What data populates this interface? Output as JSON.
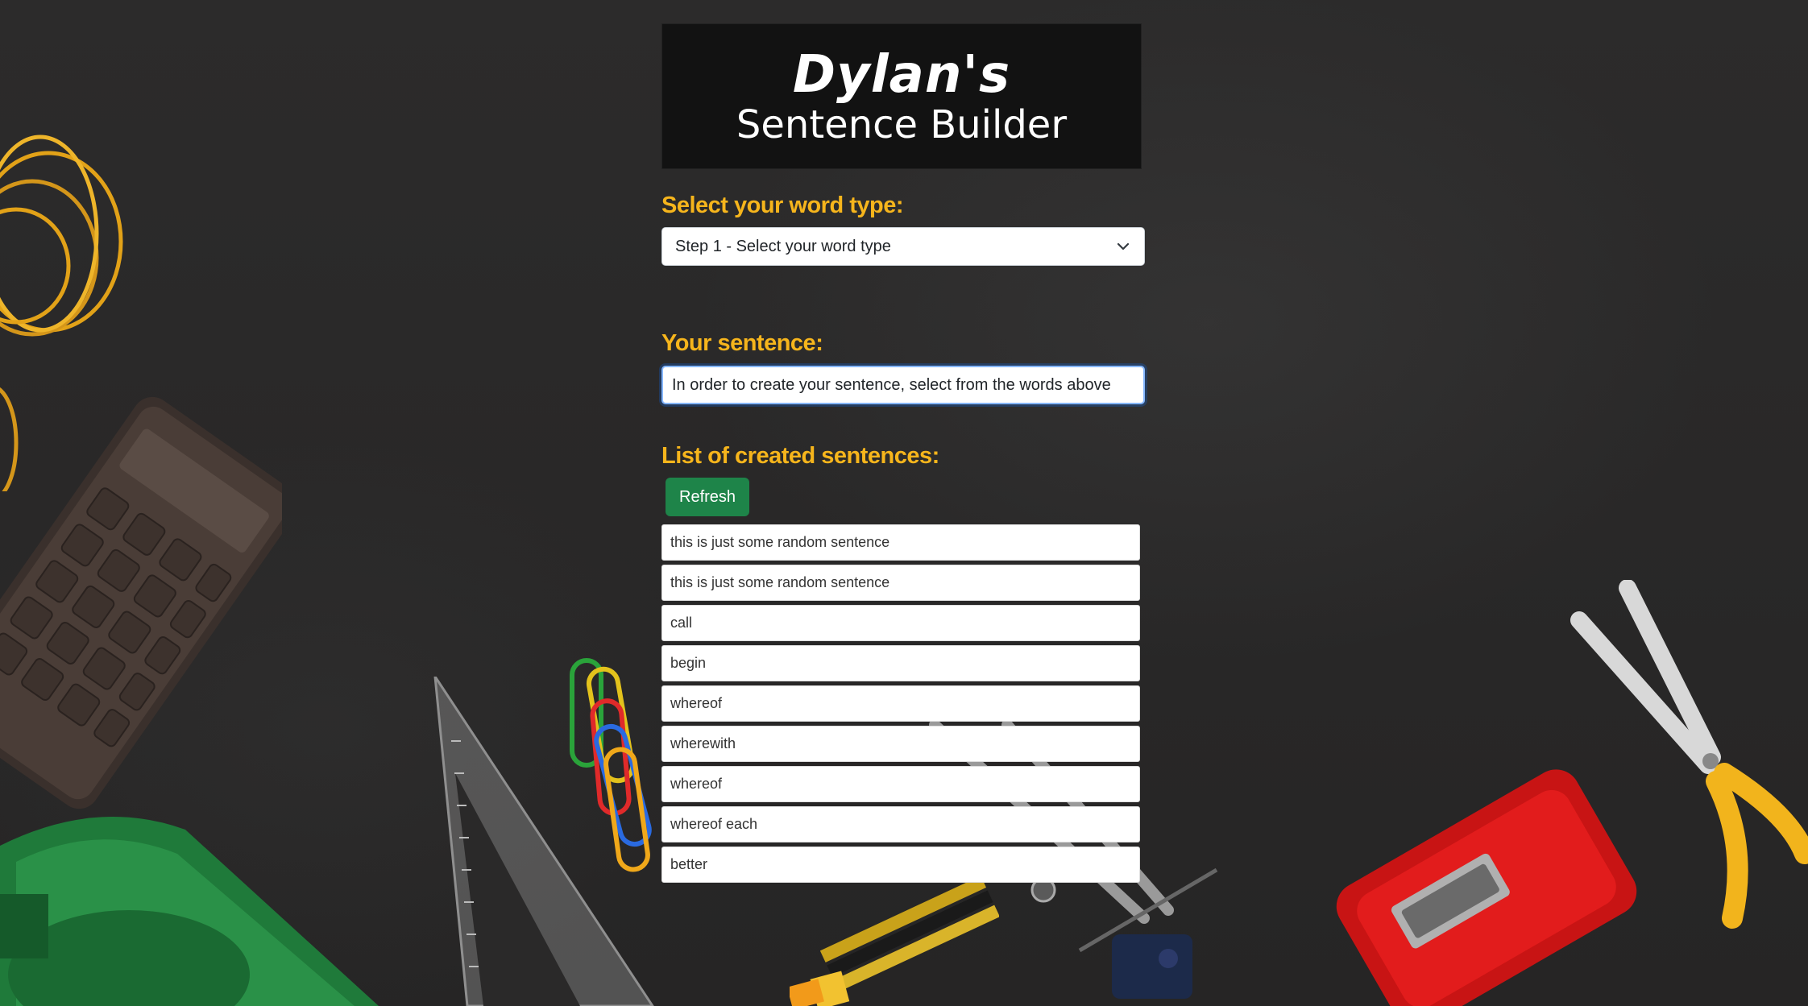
{
  "logo": {
    "title": "Dylan's",
    "subtitle": "Sentence Builder"
  },
  "word_type": {
    "label": "Select your word type:",
    "selected": "Step 1 - Select your word type"
  },
  "sentence": {
    "label": "Your sentence:",
    "value": "In order to create your sentence, select from the words above"
  },
  "created": {
    "label": "List of created sentences:",
    "refresh_label": "Refresh",
    "items": [
      "this is just some random sentence",
      "this is just some random sentence",
      "call",
      "begin",
      "whereof",
      "wherewith",
      "whereof",
      "whereof each",
      "better"
    ]
  },
  "colors": {
    "accent": "#f6b51c",
    "button": "#1e8449"
  }
}
